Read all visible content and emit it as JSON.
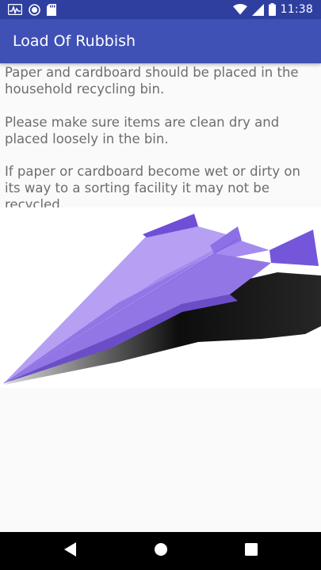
{
  "status_bar": {
    "time": "11:38",
    "icons": [
      "activity-icon",
      "circle-notification-icon",
      "sd-card-icon",
      "wifi-icon",
      "signal-icon",
      "battery-icon"
    ]
  },
  "app_bar": {
    "title": "Load Of Rubbish"
  },
  "content": {
    "paragraphs": [
      "Paper and cardboard should be placed in the household recycling bin.",
      "Please make sure items are clean dry and placed loosely in the bin.",
      "If paper or cardboard become wet or dirty on its way to a sorting facility it may not be recycled."
    ],
    "image": "paper-airplane-image"
  },
  "nav_bar": {
    "buttons": [
      "back-icon",
      "home-icon",
      "recents-icon"
    ]
  },
  "colors": {
    "status_bar": "#2f3fa0",
    "app_bar": "#3f51b5",
    "text": "#6d6d6d",
    "background": "#fafafa",
    "plane": "#8c6fe6"
  }
}
